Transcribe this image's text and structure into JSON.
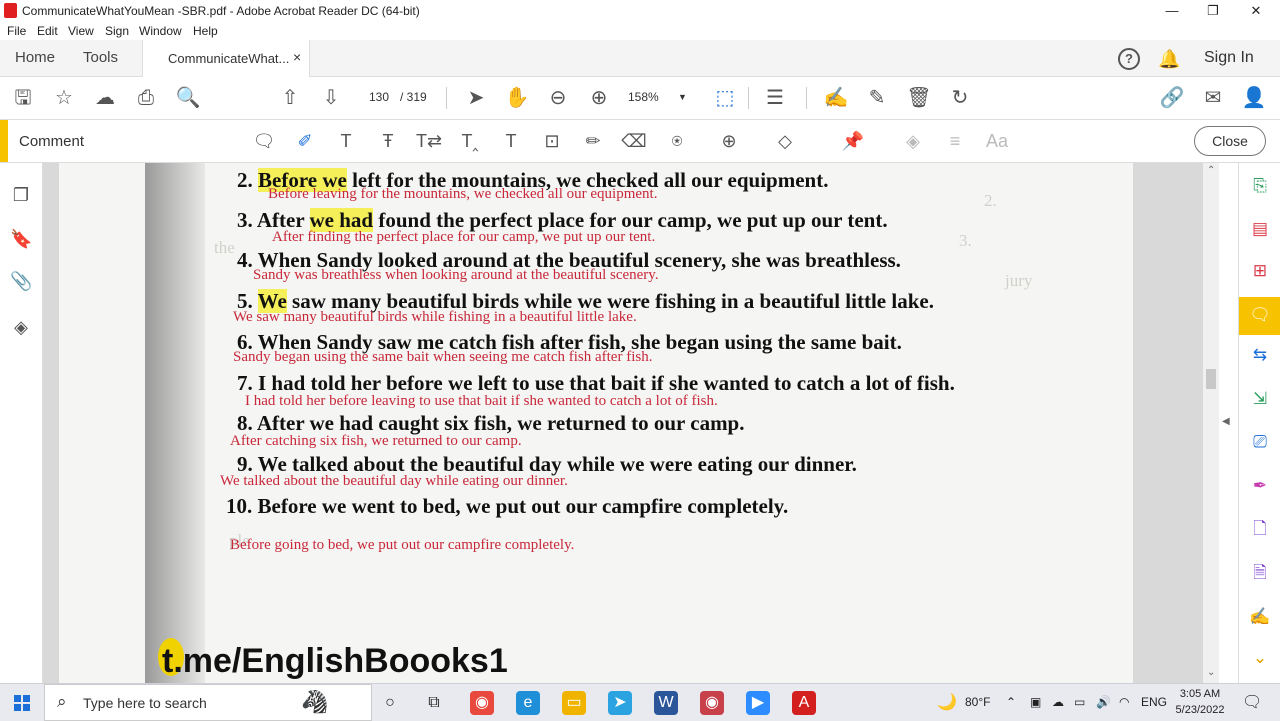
{
  "window": {
    "title": "CommunicateWhatYouMean -SBR.pdf - Adobe Acrobat Reader DC (64-bit)",
    "minimize": "—",
    "maximize": "❐",
    "close": "✕"
  },
  "menu": [
    "File",
    "Edit",
    "View",
    "Sign",
    "Window",
    "Help"
  ],
  "tabs": {
    "home": "Home",
    "tools": "Tools",
    "document": "CommunicateWhat...",
    "help": "?",
    "sign_in": "Sign In"
  },
  "toolbar": {
    "page_current": "130",
    "page_total": "/ 319",
    "zoom": "158%"
  },
  "comment_bar": {
    "label": "Comment",
    "close": "Close"
  },
  "document": {
    "lines": [
      {
        "num": "2.",
        "pre": "",
        "hl": "Before we",
        "post": " left for the mountains, we checked all our equipment."
      },
      {
        "num": "3.",
        "pre": "After ",
        "hl": "we had",
        "post": " found the perfect place for our camp, we put up our tent."
      },
      {
        "num": "4.",
        "pre": "When Sandy looked around at the beautiful scenery, she was breathless.",
        "hl": "",
        "post": ""
      },
      {
        "num": "5.",
        "pre": "",
        "hl": "We",
        "post": " saw many beautiful birds while we were fishing in a beautiful little lake."
      },
      {
        "num": "6.",
        "pre": "When Sandy saw me catch fish after fish, she began using the same bait.",
        "hl": "",
        "post": ""
      },
      {
        "num": "7.",
        "pre": "I had told her before we left to use that bait if she wanted to catch a lot of fish.",
        "hl": "",
        "post": ""
      },
      {
        "num": "8.",
        "pre": "After we had caught six fish, we returned to our camp.",
        "hl": "",
        "post": ""
      },
      {
        "num": "9.",
        "pre": "We talked about the beautiful day while we were eating our dinner.",
        "hl": "",
        "post": ""
      },
      {
        "num": "10.",
        "pre": "Before we went to bed, we put out our campfire completely.",
        "hl": "",
        "post": ""
      }
    ],
    "revisions": [
      "Before leaving for the mountains, we checked all our equipment.",
      "After finding the perfect place for our camp, we put up our tent.",
      "Sandy was breathless when looking around at the beautiful scenery.",
      "We saw many beautiful birds while fishing in a beautiful little lake.",
      "Sandy began using the same bait when seeing me catch fish after fish.",
      "I had told her before leaving to use that bait if she wanted to catch a lot of fish.",
      "After catching six fish, we returned to our camp.",
      "We talked about the beautiful day while eating our dinner.",
      "Before going to bed, we put out our campfire completely."
    ]
  },
  "watermark": "t.me/EnglishBoooks1",
  "taskbar": {
    "search_placeholder": "Type here to search",
    "weather": "80°F",
    "language": "ENG",
    "time": "3:05 AM",
    "date": "5/23/2022"
  },
  "colors": {
    "accent": "#f7c300",
    "highlight": "#f5ef5a",
    "revision_text": "#c8283a",
    "acrobat_red": "#e02020"
  }
}
